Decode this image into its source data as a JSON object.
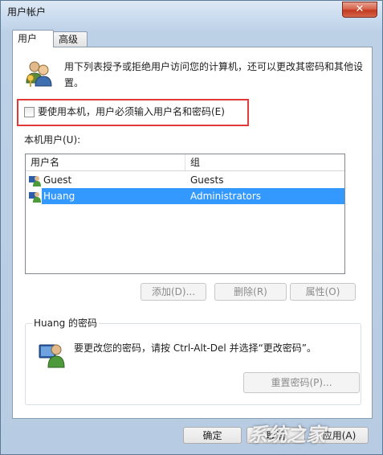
{
  "window": {
    "title": "用户帐户",
    "close_symbol": "✕"
  },
  "tabs": [
    {
      "label": "用户",
      "active": true
    },
    {
      "label": "高级",
      "active": false
    }
  ],
  "intro": {
    "icon": "users-icon",
    "text": "用下列表授予或拒绝用户访问您的计算机，还可以更改其密码和其他设置。"
  },
  "require_login": {
    "label": "要使用本机，用户必须输入用户名和密码(E)",
    "checked": false,
    "highlight_color": "#e03a3a"
  },
  "users": {
    "label": "本机用户(U):",
    "columns": [
      "用户名",
      "组"
    ],
    "rows": [
      {
        "name": "Guest",
        "group": "Guests",
        "icon": "user-icon",
        "selected": false
      },
      {
        "name": "Huang",
        "group": "Administrators",
        "icon": "user-icon",
        "selected": true
      }
    ],
    "selection_color": "#3399ff"
  },
  "user_buttons": {
    "add": "添加(D)...",
    "remove": "删除(R)",
    "properties": "属性(O)"
  },
  "password": {
    "group_title": "Huang 的密码",
    "icon": "user-key-icon",
    "text": "要更改您的密码，请按 Ctrl-Alt-Del 并选择“更改密码”。",
    "reset_button": "重置密码(P)..."
  },
  "dialog_buttons": {
    "ok": "确定",
    "cancel": "取消",
    "apply": "应用(A)"
  },
  "watermark": "系统之家"
}
